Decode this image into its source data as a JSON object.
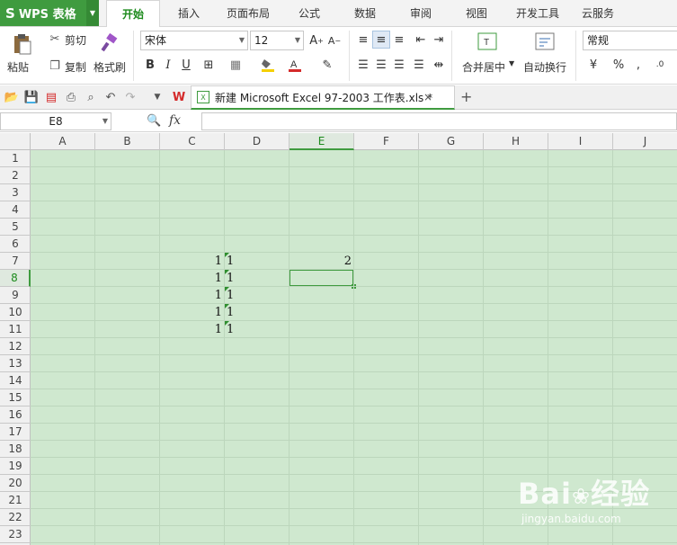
{
  "app": {
    "name": "WPS 表格",
    "logo_letter": "S"
  },
  "ribbon_tabs": [
    "开始",
    "插入",
    "页面布局",
    "公式",
    "数据",
    "审阅",
    "视图",
    "开发工具",
    "云服务"
  ],
  "active_tab": "开始",
  "clipboard": {
    "paste": "粘贴",
    "cut": "剪切",
    "copy": "复制",
    "format_painter": "格式刷"
  },
  "font": {
    "name": "宋体",
    "size": "12"
  },
  "alignment": {
    "merge_center": "合并居中",
    "wrap_text": "自动换行"
  },
  "number": {
    "format": "常规"
  },
  "document": {
    "tab_title": "新建 Microsoft Excel 97-2003 工作表.xls *"
  },
  "formula_bar": {
    "name_box": "E8",
    "fx": "fx",
    "value": ""
  },
  "columns": [
    "A",
    "B",
    "C",
    "D",
    "E",
    "F",
    "G",
    "H",
    "I",
    "J"
  ],
  "rows": [
    "1",
    "2",
    "3",
    "4",
    "5",
    "6",
    "7",
    "8",
    "9",
    "10",
    "11",
    "12",
    "13",
    "14",
    "15",
    "16",
    "17",
    "18",
    "19",
    "20",
    "21",
    "22",
    "23"
  ],
  "selected_cell": {
    "column": "E",
    "row": "8"
  },
  "cells": {
    "C7": "1",
    "D7": "1",
    "E7": "2",
    "C8": "1",
    "D8": "1",
    "C9": "1",
    "D9": "1",
    "C10": "1",
    "D10": "1",
    "C11": "1",
    "D11": "1"
  },
  "colors": {
    "accent": "#3f9b3f",
    "grid_bg": "#cfe8cf"
  }
}
